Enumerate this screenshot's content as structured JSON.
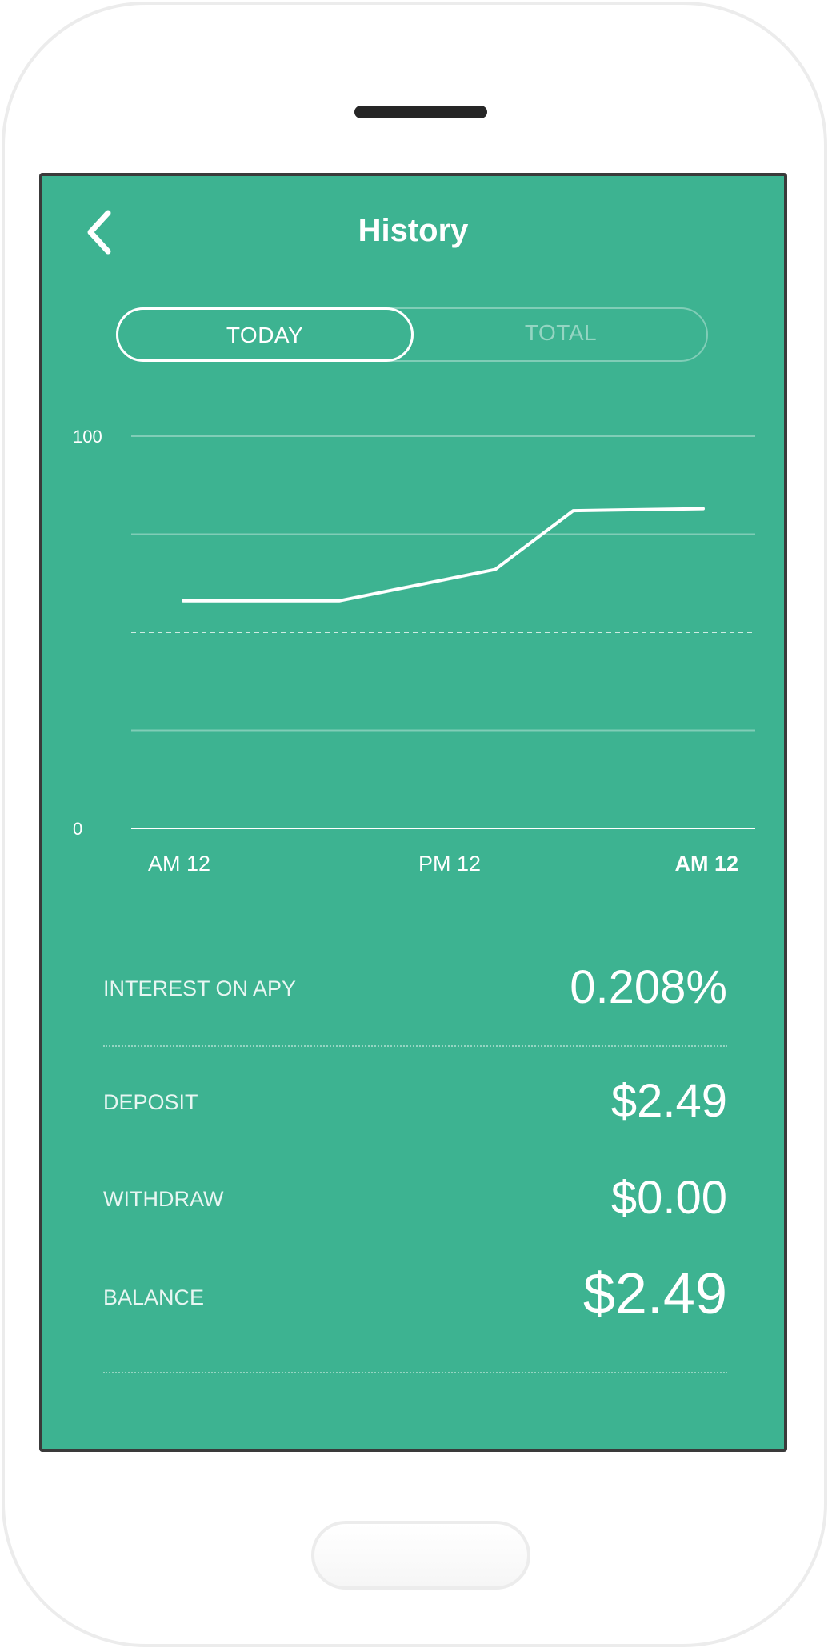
{
  "header": {
    "back_icon": "chevron-left-icon",
    "title": "History"
  },
  "tabs": [
    {
      "label": "TODAY",
      "active": true
    },
    {
      "label": "TOTAL",
      "active": false
    }
  ],
  "chart_data": {
    "type": "line",
    "y_tick_labels": [
      "100",
      "0"
    ],
    "ylim": [
      0,
      100
    ],
    "grid": true,
    "reference_line": {
      "y": 50,
      "style": "dashed"
    },
    "x_tick_labels": [
      "AM 12",
      "PM 12",
      "AM 12"
    ],
    "xlim": [
      0,
      24
    ],
    "series": [
      {
        "x": [
          2,
          8,
          14,
          17,
          22
        ],
        "y": [
          58,
          58,
          66,
          81,
          81.5
        ]
      }
    ]
  },
  "stats": {
    "interest_label": "INTEREST ON APY",
    "interest_value": "0.208%",
    "deposit_label": "DEPOSIT",
    "deposit_value": "$2.49",
    "withdraw_label": "WITHDRAW",
    "withdraw_value": "$0.00",
    "balance_label": "BALANCE",
    "balance_value": "$2.49"
  },
  "colors": {
    "screen_background": "#3db391",
    "text": "#ffffff"
  }
}
